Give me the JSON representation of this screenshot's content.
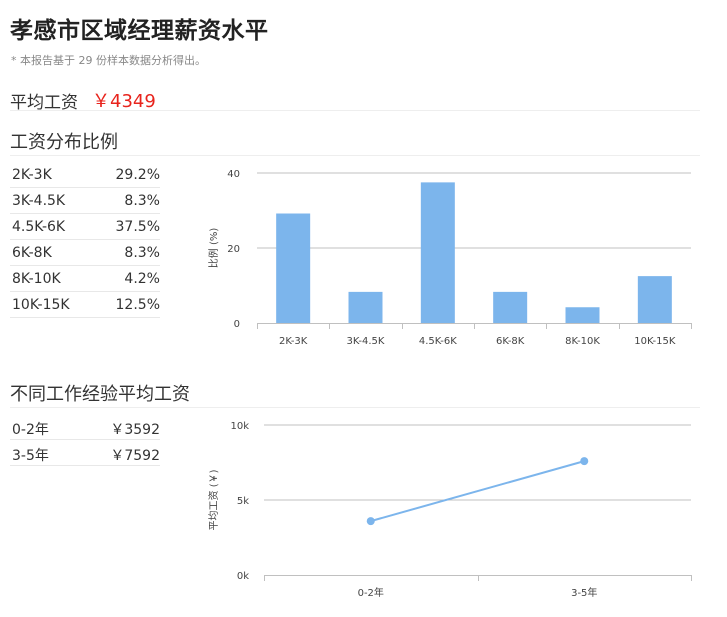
{
  "page": {
    "title": "孝感市区域经理薪资水平",
    "note": "* 本报告基于 29 份样本数据分析得出。"
  },
  "average": {
    "label": "平均工资",
    "value": "￥4349"
  },
  "distribution": {
    "section_title": "工资分布比例",
    "rows": [
      {
        "label": "2K-3K",
        "value": "29.2%"
      },
      {
        "label": "3K-4.5K",
        "value": "8.3%"
      },
      {
        "label": "4.5K-6K",
        "value": "37.5%"
      },
      {
        "label": "6K-8K",
        "value": "8.3%"
      },
      {
        "label": "8K-10K",
        "value": "4.2%"
      },
      {
        "label": "10K-15K",
        "value": "12.5%"
      }
    ]
  },
  "experience": {
    "section_title": "不同工作经验平均工资",
    "rows": [
      {
        "label": "0-2年",
        "value": "￥3592"
      },
      {
        "label": "3-5年",
        "value": "￥7592"
      }
    ]
  },
  "colors": {
    "accent_red": "#e8231c",
    "bar_blue": "#7cb5ec",
    "grid": "#c0c0c0"
  },
  "chart_data": [
    {
      "type": "bar",
      "categories": [
        "2K-3K",
        "3K-4.5K",
        "4.5K-6K",
        "6K-8K",
        "8K-10K",
        "10K-15K"
      ],
      "values": [
        29.2,
        8.3,
        37.5,
        8.3,
        4.2,
        12.5
      ],
      "ylabel": "比例 (%)",
      "yticks": [
        "0",
        "20",
        "40"
      ],
      "ylim": [
        0,
        40
      ],
      "grid": true
    },
    {
      "type": "line",
      "categories": [
        "0-2年",
        "3-5年"
      ],
      "values": [
        3592,
        7592
      ],
      "ylabel": "平均工资 (￥)",
      "yticks": [
        "0k",
        "5k",
        "10k"
      ],
      "ylim": [
        0,
        10000
      ],
      "grid": true
    }
  ]
}
